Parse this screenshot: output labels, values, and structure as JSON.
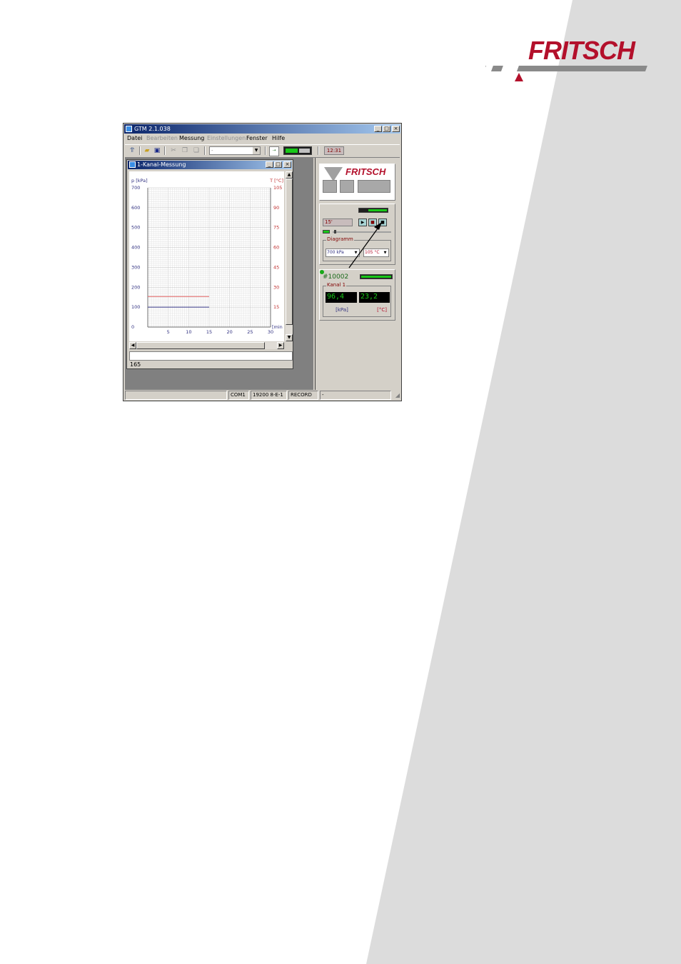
{
  "brand": {
    "name": "FRITSCH",
    "color": "#b3102b"
  },
  "window": {
    "title": "GTM 2.1.038",
    "controls": [
      "_",
      "□",
      "×"
    ]
  },
  "menu": [
    "Datei",
    "Bearbeiten",
    "Messung",
    "Einstellungen",
    "Fenster",
    "Hilfe"
  ],
  "toolbar": {
    "combo_value": "-",
    "clock": "12:31"
  },
  "child_window": {
    "title": "1-Kanal-Messung",
    "status_value": "165"
  },
  "chart_data": {
    "type": "line",
    "xlabel": "[min",
    "ylabel_left": "p [kPa]",
    "ylabel_right": "T [°C]",
    "x_ticks": [
      5,
      10,
      15,
      20,
      25,
      30
    ],
    "y_left_ticks": [
      0,
      100,
      200,
      300,
      400,
      500,
      600,
      700
    ],
    "y_right_ticks": [
      15,
      30,
      45,
      60,
      75,
      90,
      105
    ],
    "xlim": [
      0,
      30
    ],
    "ylim_left": [
      0,
      700
    ],
    "ylim_right": [
      0,
      105
    ],
    "grid": true,
    "series": [
      {
        "axis": "right",
        "color": "#e06060",
        "x": [
          0,
          15
        ],
        "y": [
          23,
          23
        ]
      },
      {
        "axis": "left",
        "color": "#303080",
        "x": [
          0,
          15
        ],
        "y": [
          100,
          100
        ]
      }
    ]
  },
  "panel_control": {
    "time_display": "15'",
    "diagram_label": "Diagramm",
    "pressure_range": "700 kPa",
    "temperature_range": "105 °C"
  },
  "panel_channel": {
    "device_id": "#10002",
    "channel_label": "Kanal 1",
    "pressure_value": "96,4",
    "temperature_value": "23,2",
    "pressure_unit": "[kPa]",
    "temperature_unit": "[°C]"
  },
  "statusbar": [
    "COM1",
    "19200  8-E-1",
    "RECORD",
    "-"
  ]
}
